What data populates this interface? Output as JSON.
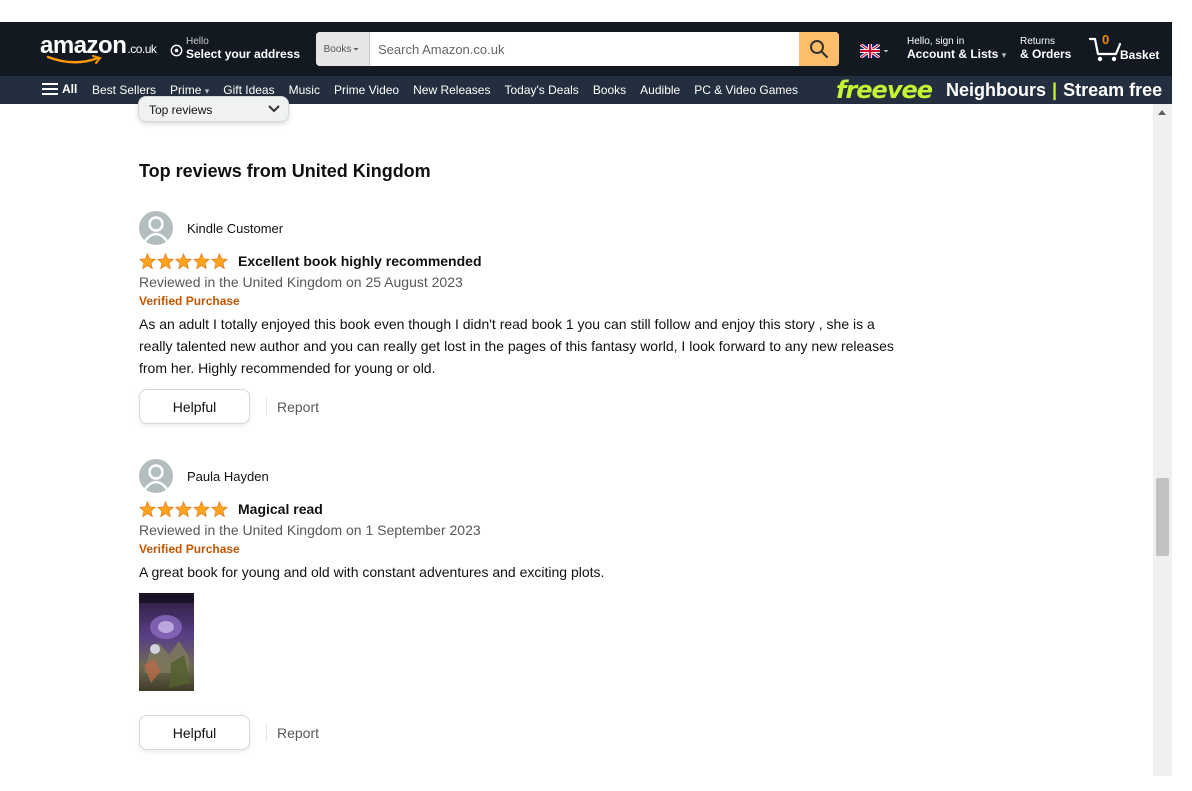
{
  "header": {
    "logo_text": "amazon",
    "logo_tld": ".co.uk",
    "deliver_small": "Hello",
    "deliver_big": "Select your address",
    "search_category": "Books",
    "search_placeholder": "Search Amazon.co.uk",
    "account_small": "Hello, sign in",
    "account_big": "Account & Lists",
    "orders_small": "Returns",
    "orders_big": "& Orders",
    "basket_count": "0",
    "basket_label": "Basket"
  },
  "nav": {
    "all_label": "All",
    "items": [
      {
        "label": "Best Sellers"
      },
      {
        "label": "Prime"
      },
      {
        "label": "Gift Ideas"
      },
      {
        "label": "Music"
      },
      {
        "label": "Prime Video"
      },
      {
        "label": "New Releases"
      },
      {
        "label": "Today's Deals"
      },
      {
        "label": "Books"
      },
      {
        "label": "Audible"
      },
      {
        "label": "PC & Video Games"
      }
    ],
    "promo_brand": "freevee",
    "promo_text": "Neighbours",
    "promo_sep": "|",
    "promo_cta": "Stream free"
  },
  "sort": {
    "selected": "Top reviews"
  },
  "reviews_section": {
    "title": "Top reviews from United Kingdom",
    "reviews": [
      {
        "author": "Kindle Customer",
        "rating": 5,
        "title": "Excellent book highly recommended",
        "date": "Reviewed in the United Kingdom on 25 August 2023",
        "verified": "Verified Purchase",
        "body": "As an adult I totally enjoyed this book even though I didn't read book 1 you can still follow and enjoy this story , she is a really talented new author and you can really get lost in the pages of this fantasy world, I look forward to any new releases from her. Highly recommended for young or old.",
        "helpful_label": "Helpful",
        "report_label": "Report"
      },
      {
        "author": "Paula Hayden",
        "rating": 5,
        "title": "Magical read",
        "date": "Reviewed in the United Kingdom on 1 September 2023",
        "verified": "Verified Purchase",
        "body": "A great book for young and old with constant adventures and exciting plots.",
        "helpful_label": "Helpful",
        "report_label": "Report"
      }
    ]
  },
  "colors": {
    "header_bg": "#131921",
    "nav_bg": "#232f3e",
    "search_button": "#febd69",
    "star": "#ffa41c",
    "verified": "#c45500",
    "promo_brand": "#c4f534"
  }
}
